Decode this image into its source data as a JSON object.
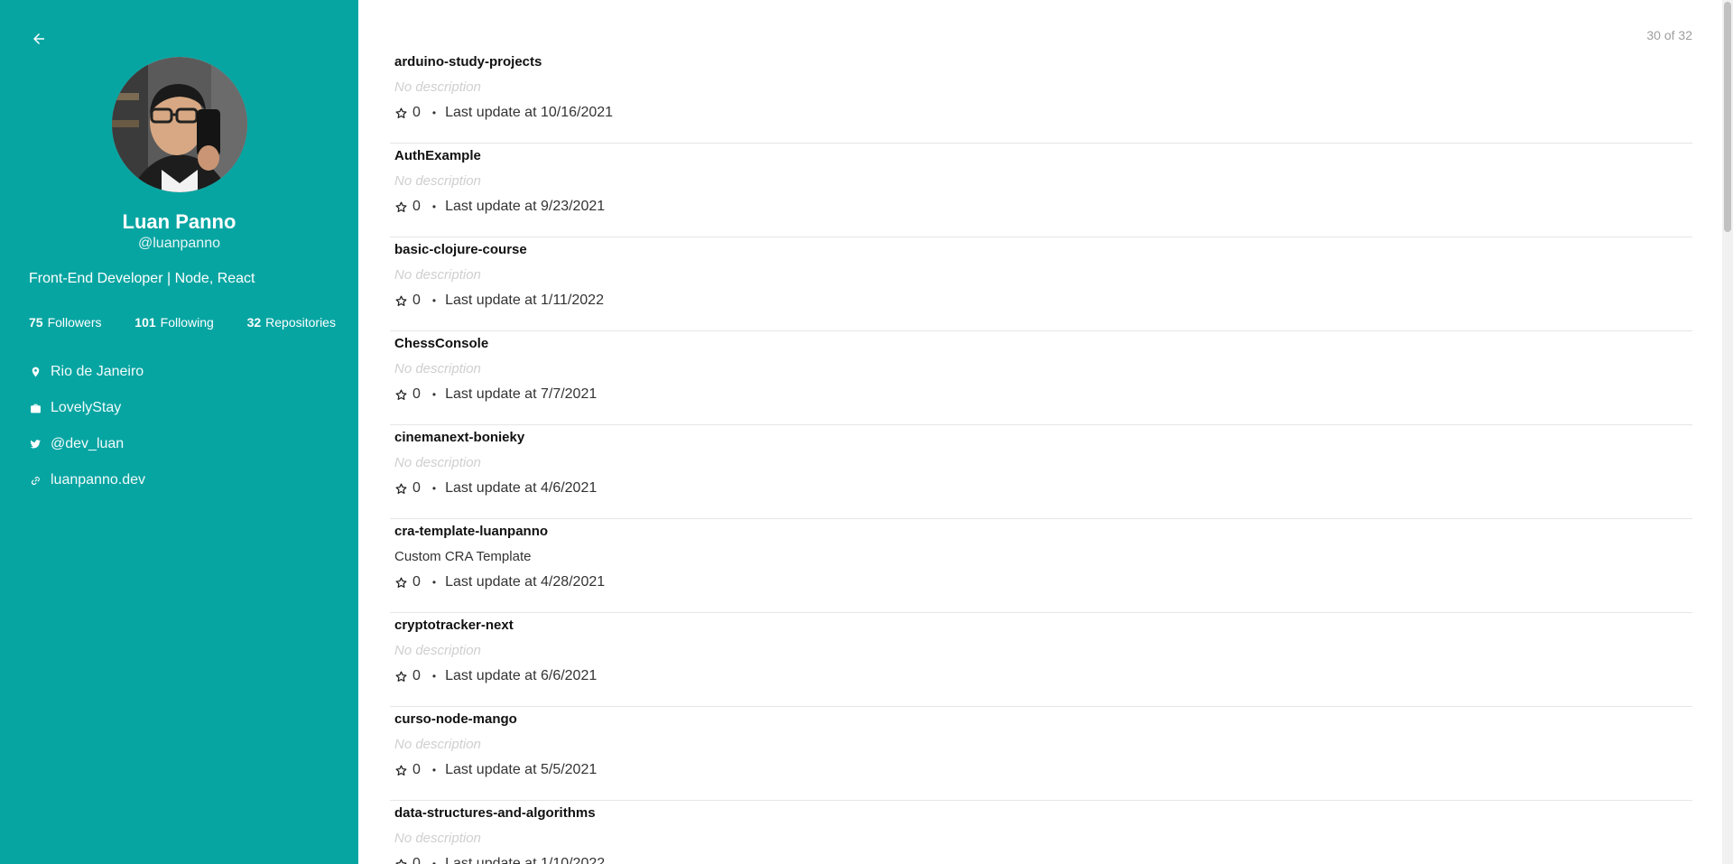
{
  "profile": {
    "name": "Luan Panno",
    "login": "@luanpanno",
    "bio": "Front-End Developer | Node, React",
    "followers_count": "75",
    "followers_label": "Followers",
    "following_count": "101",
    "following_label": "Following",
    "repos_count": "32",
    "repos_label": "Repositories",
    "location": "Rio de Janeiro",
    "company": "LovelyStay",
    "twitter": "@dev_luan",
    "website": "luanpanno.dev"
  },
  "colors": {
    "sidebar": "#07a5a2",
    "placeholder_text": "#cfcfcf"
  },
  "repos_count_label": "30 of 32",
  "repos": [
    {
      "name": "arduino-study-projects",
      "description": "No description",
      "stars": "0",
      "updated": "Last update at 10/16/2021"
    },
    {
      "name": "AuthExample",
      "description": "No description",
      "stars": "0",
      "updated": "Last update at 9/23/2021"
    },
    {
      "name": "basic-clojure-course",
      "description": "No description",
      "stars": "0",
      "updated": "Last update at 1/11/2022"
    },
    {
      "name": "ChessConsole",
      "description": "No description",
      "stars": "0",
      "updated": "Last update at 7/7/2021"
    },
    {
      "name": "cinemanext-bonieky",
      "description": "No description",
      "stars": "0",
      "updated": "Last update at 4/6/2021"
    },
    {
      "name": "cra-template-luanpanno",
      "description": "Custom CRA Template",
      "stars": "0",
      "updated": "Last update at 4/28/2021"
    },
    {
      "name": "cryptotracker-next",
      "description": "No description",
      "stars": "0",
      "updated": "Last update at 6/6/2021"
    },
    {
      "name": "curso-node-mango",
      "description": "No description",
      "stars": "0",
      "updated": "Last update at 5/5/2021"
    },
    {
      "name": "data-structures-and-algorithms",
      "description": "No description",
      "stars": "0",
      "updated": "Last update at 1/10/2022"
    }
  ],
  "icons": {
    "back": "arrow-left-icon",
    "location": "location-pin-icon",
    "company": "briefcase-icon",
    "twitter": "twitter-icon",
    "website": "link-icon",
    "star": "star-outline-icon"
  }
}
